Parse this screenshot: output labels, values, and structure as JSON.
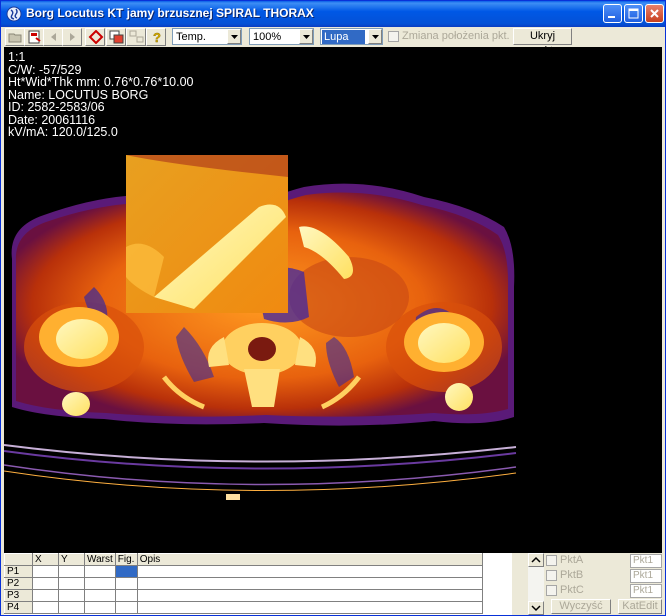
{
  "window": {
    "title": "Borg Locutus KT jamy brzusznej SPIRAL THORAX",
    "accent": "#0058e6"
  },
  "toolbar": {
    "icons": [
      "open-icon",
      "save-icon",
      "prev-icon",
      "next-icon",
      "tag-icon",
      "copy-icon",
      "layout-icon",
      "help-icon"
    ],
    "colormap_value": "Temp.",
    "zoom_value": "100%",
    "tool_value": "Lupa",
    "change_points_label": "Zmiana położenia pkt.",
    "hide_points_label": "Ukryj punkty"
  },
  "overlay": {
    "scale": "1:1",
    "cw": "C/W: -57/529",
    "dims": "Ht*Wid*Thk mm: 0.76*0.76*10.00",
    "name": "Name: LOCUTUS BORG",
    "id": "ID: 2582-2583/06",
    "date": "Date: 20061116",
    "kvma": "kV/mA: 120.0/125.0"
  },
  "grid": {
    "headers": [
      "",
      "X",
      "Y",
      "Warst",
      "Fig.",
      "Opis"
    ],
    "rows": [
      "P1",
      "P2",
      "P3",
      "P4"
    ]
  },
  "side": {
    "pkta": "PktA",
    "pktb": "PktB",
    "pktc": "PktC",
    "field1": "Pkt1",
    "field2": "Pkt1",
    "field3": "Pkt1",
    "clear_label": "Wyczyść",
    "kat_label": "KatEdit"
  }
}
